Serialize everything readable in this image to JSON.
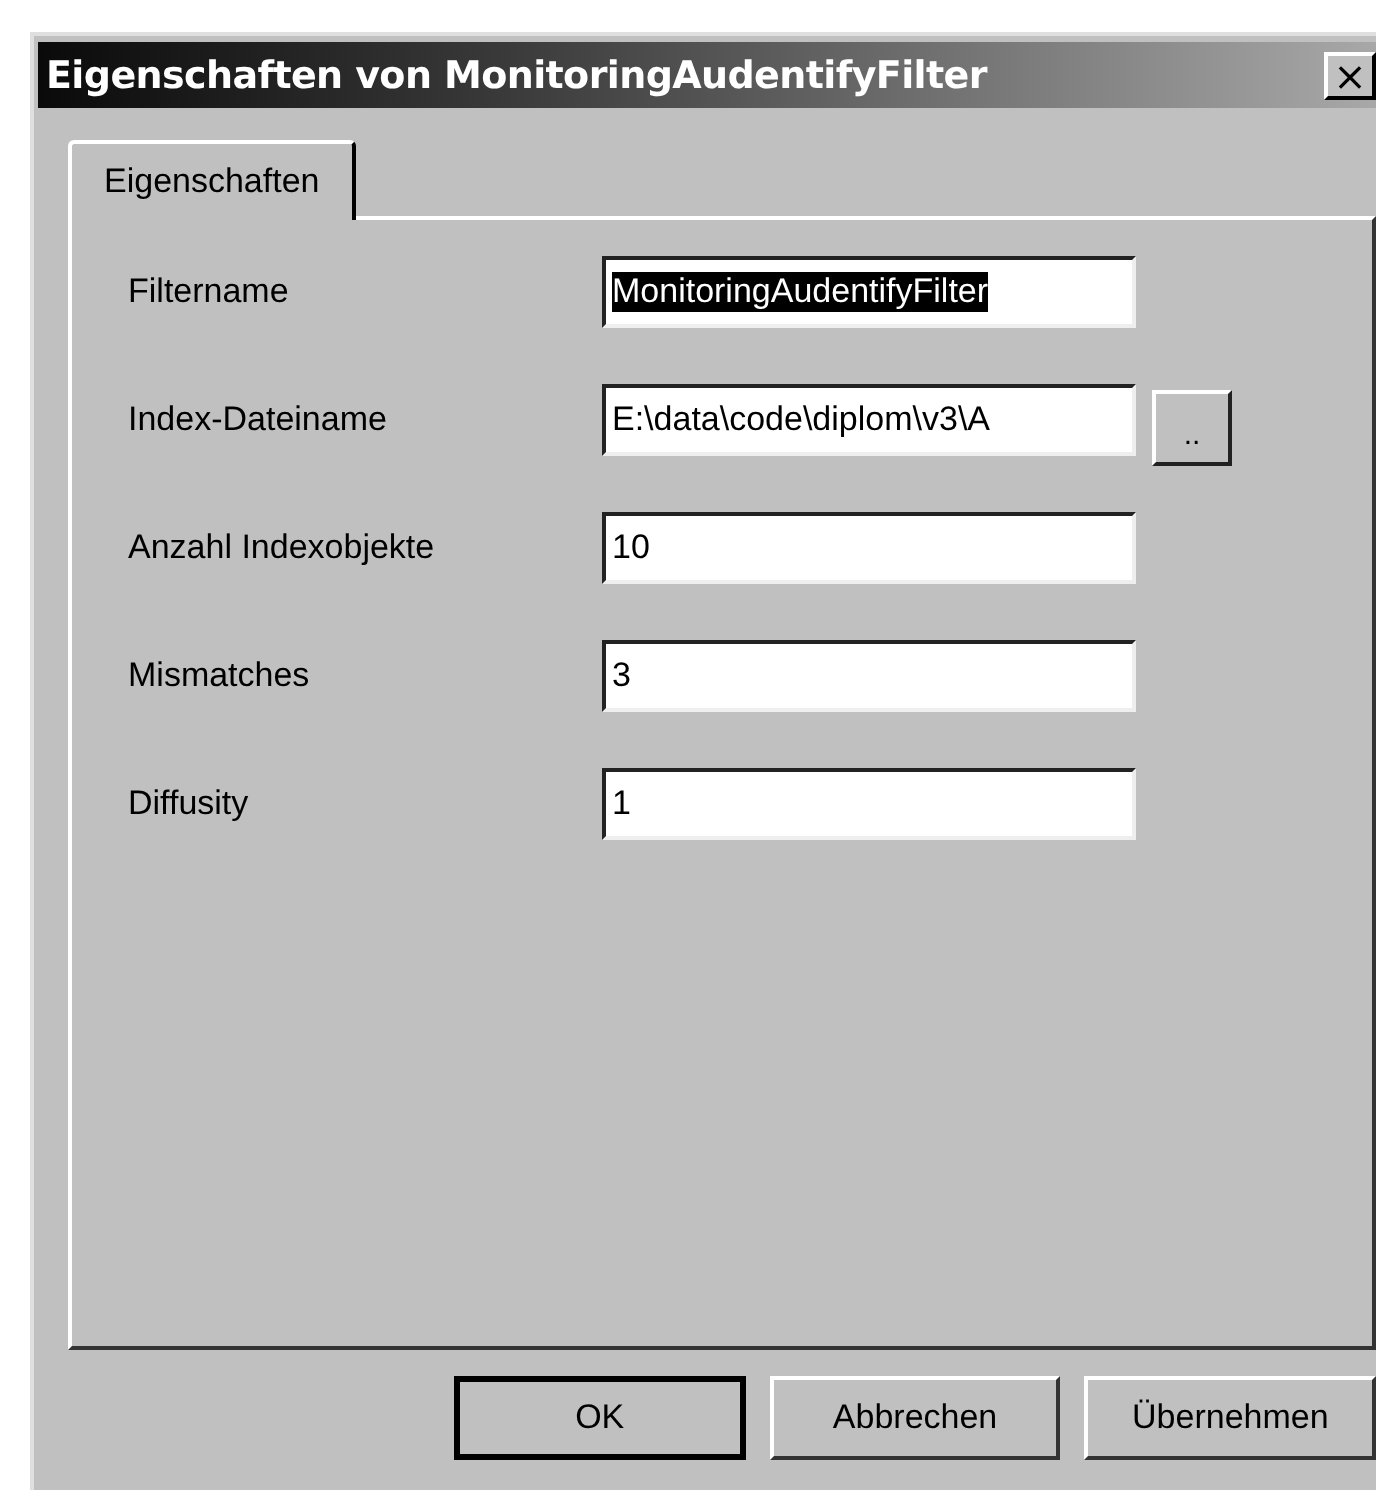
{
  "window": {
    "title": "Eigenschaften von MonitoringAudentifyFilter",
    "close": "×"
  },
  "tabs": [
    {
      "label": "Eigenschaften",
      "selected": true
    }
  ],
  "fields": [
    {
      "label": "Filtername",
      "value": "MonitoringAudentifyFilter",
      "text_selected": true
    },
    {
      "label": "Index-Dateiname",
      "value": "E:\\data\\code\\diplom\\v3\\A",
      "text_selected": false,
      "browse": ".."
    },
    {
      "label": "Anzahl Indexobjekte",
      "value": "10",
      "text_selected": false
    },
    {
      "label": "Mismatches",
      "value": "3",
      "text_selected": false
    },
    {
      "label": "Diffusity",
      "value": "1",
      "text_selected": false
    }
  ],
  "buttons": [
    {
      "label": "OK",
      "default": true
    },
    {
      "label": "Abbrechen",
      "default": false
    },
    {
      "label": "Übernehmen",
      "default": false
    }
  ]
}
